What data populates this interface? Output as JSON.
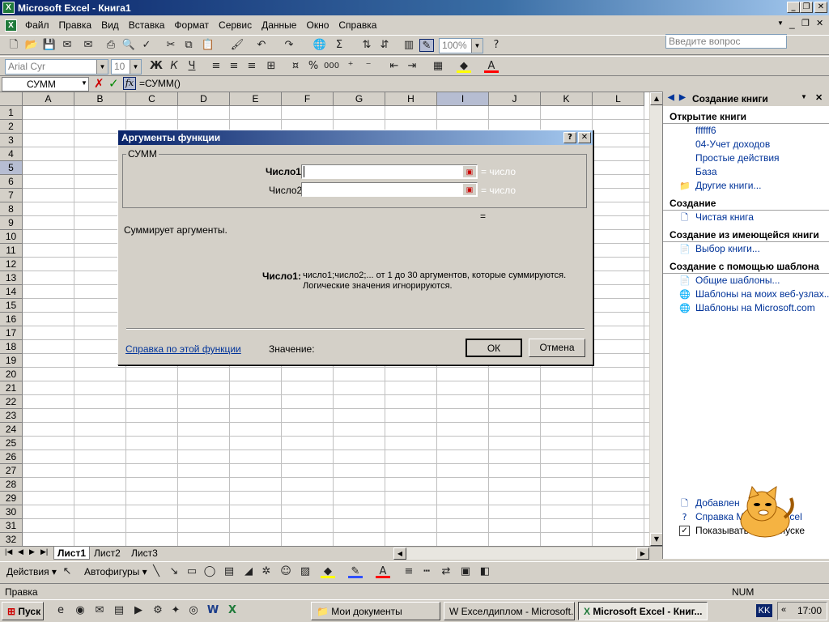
{
  "window": {
    "title": "Microsoft Excel - Книга1"
  },
  "menu": {
    "items": [
      "Файл",
      "Правка",
      "Вид",
      "Вставка",
      "Формат",
      "Сервис",
      "Данные",
      "Окно",
      "Справка"
    ],
    "ask_placeholder": "Введите вопрос"
  },
  "toolbar": {
    "zoom": "100%",
    "font": "Arial Cyr",
    "size": "10"
  },
  "formula": {
    "namebox": "СУММ",
    "content": "=СУММ()"
  },
  "grid": {
    "columns": [
      "A",
      "B",
      "C",
      "D",
      "E",
      "F",
      "G",
      "H",
      "I",
      "J",
      "K",
      "L"
    ],
    "rows": [
      "1",
      "2",
      "3",
      "4",
      "5",
      "6",
      "7",
      "8",
      "9",
      "10",
      "11",
      "12",
      "13",
      "14",
      "15",
      "16",
      "17",
      "18",
      "19",
      "20",
      "21",
      "22",
      "23",
      "24",
      "25",
      "26",
      "27",
      "28",
      "29",
      "30",
      "31",
      "32"
    ]
  },
  "sheets": [
    "Лист1",
    "Лист2",
    "Лист3"
  ],
  "drawing": {
    "actions": "Действия",
    "autoshapes": "Автофигуры"
  },
  "status": {
    "left": "Правка",
    "num": "NUM"
  },
  "taskpane": {
    "title": "Создание книги",
    "open_header": "Открытие книги",
    "recent": [
      "ffffff6",
      "04-Учет доходов",
      "Простые действия",
      "База"
    ],
    "more": "Другие книги...",
    "create_header": "Создание",
    "blank": "Чистая книга",
    "from_existing_header": "Создание из имеющейся книги",
    "choose": "Выбор книги...",
    "template_header": "Создание с помощью шаблона",
    "templates": [
      "Общие шаблоны...",
      "Шаблоны на моих веб-узлах...",
      "Шаблоны на Microsoft.com"
    ],
    "bottom": [
      "Добавлен",
      "Справка Microsoft Excel",
      "Показывать при запуске"
    ]
  },
  "dialog": {
    "title": "Аргументы функции",
    "group": "СУММ",
    "arg1_label": "Число1",
    "arg2_label": "Число2",
    "arg_hint": "= число",
    "eq": "=",
    "description": "Суммирует аргументы.",
    "arg_detail_label": "Число1:",
    "arg_detail_1": "число1;число2;... от 1 до 30 аргументов, которые суммируются.",
    "arg_detail_2": "Логические значения игнорируются.",
    "help_link": "Справка по этой функции",
    "value_label": "Значение:",
    "ok": "ОК",
    "cancel": "Отмена"
  },
  "taskbar": {
    "start": "Пуск",
    "tasks": [
      "Мои документы",
      "Exceлдиплом - Microsoft...",
      "Microsoft Excel - Книг..."
    ],
    "lang": "KK",
    "time": "17:00"
  }
}
